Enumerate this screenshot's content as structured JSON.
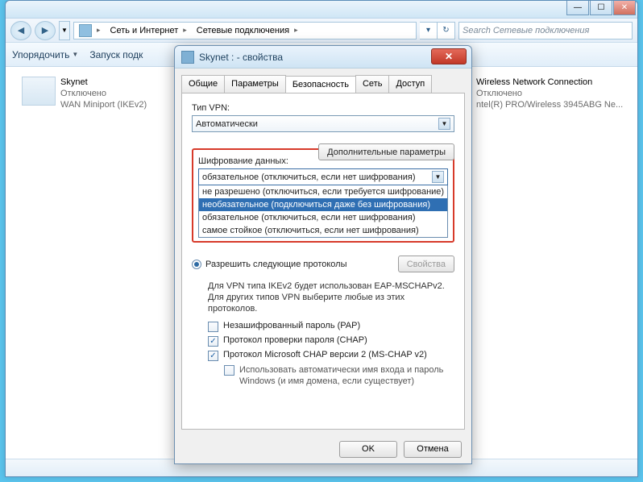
{
  "explorer": {
    "breadcrumb": {
      "seg1": "Сеть и Интернет",
      "seg2": "Сетевые подключения"
    },
    "search_placeholder": "Search Сетевые подключения",
    "toolbar": {
      "organize": "Упорядочить",
      "start": "Запуск подк"
    },
    "conn_left": {
      "name": "Skynet",
      "status": "Отключено",
      "device": "WAN Miniport (IKEv2)"
    },
    "conn_right": {
      "name": "Wireless Network Connection",
      "status": "Отключено",
      "device": "ntel(R) PRO/Wireless 3945ABG Ne..."
    }
  },
  "dialog": {
    "title": "Skynet :  - свойства",
    "tabs": {
      "t1": "Общие",
      "t2": "Параметры",
      "t3": "Безопасность",
      "t4": "Сеть",
      "t5": "Доступ"
    },
    "vpn_type_label": "Тип VPN:",
    "vpn_type_value": "Автоматически",
    "adv_btn": "Дополнительные параметры",
    "enc_label": "Шифрование данных:",
    "enc_value": "обязательное (отключиться, если нет шифрования)",
    "enc_opts": {
      "o1": "не разрешено (отключиться, если требуется шифрование)",
      "o2": "необязательное (подключиться даже без шифрования)",
      "o3": "обязательное (отключиться, если нет шифрования)",
      "o4": "самое стойкое (отключиться, если нет шифрования)"
    },
    "radio_allow": "Разрешить следующие протоколы",
    "props_btn": "Свойства",
    "eap_note": "Для VPN типа IKEv2 будет использован EAP-MSCHAPv2. Для других типов VPN выберите любые из этих протоколов.",
    "chk_pap": "Незашифрованный пароль (PAP)",
    "chk_chap": "Протокол проверки пароля (CHAP)",
    "chk_mschap": "Протокол Microsoft CHAP версии 2 (MS-CHAP v2)",
    "chk_auto": "Использовать автоматически имя входа и пароль Windows (и имя домена, если существует)",
    "ok": "OK",
    "cancel": "Отмена"
  }
}
